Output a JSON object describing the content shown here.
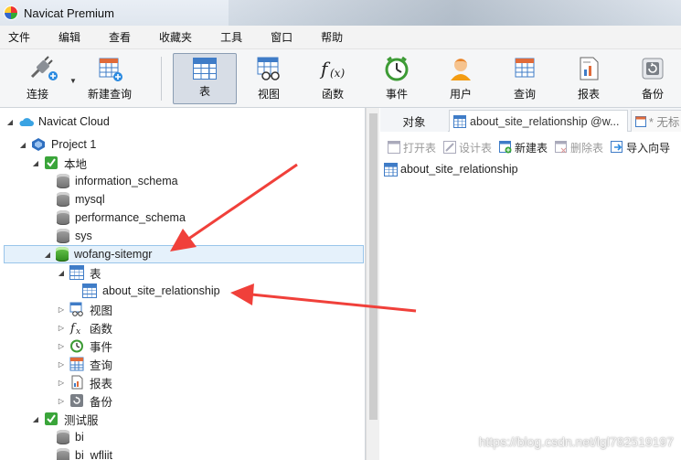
{
  "window": {
    "title": "Navicat Premium"
  },
  "menu": [
    "文件",
    "编辑",
    "查看",
    "收藏夹",
    "工具",
    "窗口",
    "帮助"
  ],
  "toolbar": {
    "connect": "连接",
    "new_query": "新建查询",
    "table": "表",
    "view": "视图",
    "function": "函数",
    "event": "事件",
    "user": "用户",
    "query": "查询",
    "report": "报表",
    "backup": "备份"
  },
  "tree": {
    "cloud": "Navicat Cloud",
    "project": "Project 1",
    "local": "本地",
    "dbs": [
      "information_schema",
      "mysql",
      "performance_schema",
      "sys"
    ],
    "selected_db": "wofang-sitemgr",
    "tables_folder": "表",
    "table_item": "about_site_relationship",
    "folders": [
      "视图",
      "函数",
      "事件",
      "查询",
      "报表",
      "备份"
    ],
    "test_conn": "测试服",
    "test_dbs": [
      "bi",
      "bi_wfliit"
    ]
  },
  "tabs": {
    "objects": "对象",
    "table_tab": "about_site_relationship @w...",
    "new_tab": "* 无标"
  },
  "obj_toolbar": {
    "open": "打开表",
    "design": "设计表",
    "new": "新建表",
    "delete": "删除表",
    "import": "导入向导"
  },
  "objects": [
    "about_site_relationship"
  ],
  "watermark": "https://blog.csdn.net/lgl782519197",
  "colors": {
    "accent": "#3f7cc7",
    "selection": "#e5f1fb",
    "arrow": "#f0403a"
  }
}
